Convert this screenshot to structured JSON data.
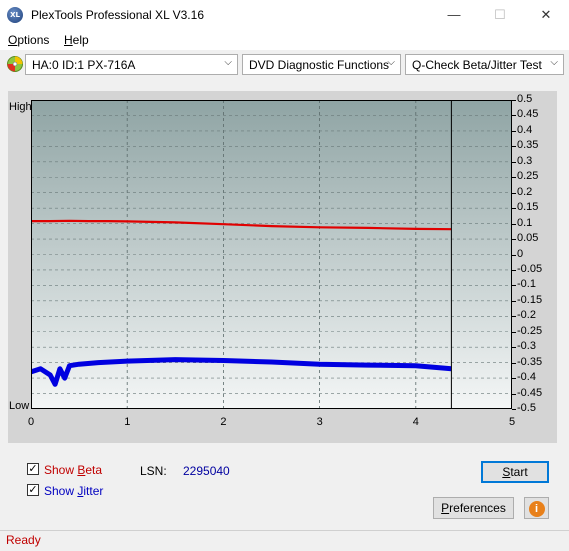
{
  "window": {
    "title": "PlexTools Professional XL V3.16",
    "icon_text": "XL",
    "minimize": "—",
    "maximize": "☐",
    "close": "✕"
  },
  "menu": {
    "options_first": "O",
    "options_rest": "ptions",
    "help_first": "H",
    "help_rest": "elp"
  },
  "toolbar": {
    "drive": "HA:0 ID:1  PX-716A",
    "function": "DVD Diagnostic Functions",
    "test": "Q-Check Beta/Jitter Test"
  },
  "chart_data": {
    "type": "line",
    "left_axis_labels": [
      "High",
      "Low"
    ],
    "x_ticks": [
      0,
      1,
      2,
      3,
      4,
      5
    ],
    "y_ticks": [
      0.5,
      0.45,
      0.4,
      0.35,
      0.3,
      0.25,
      0.2,
      0.15,
      0.1,
      0.05,
      0,
      -0.05,
      -0.1,
      -0.15,
      -0.2,
      -0.25,
      -0.3,
      -0.35,
      -0.4,
      -0.45,
      -0.5
    ],
    "xlim": [
      0,
      5
    ],
    "ylim": [
      -0.5,
      0.5
    ],
    "end_marker_x": 4.37,
    "series": [
      {
        "name": "Beta",
        "color": "#e00000",
        "x": [
          0,
          0.2,
          0.4,
          0.6,
          0.8,
          1.0,
          1.5,
          2.0,
          2.5,
          3.0,
          3.5,
          4.0,
          4.37
        ],
        "y": [
          0.108,
          0.108,
          0.109,
          0.108,
          0.108,
          0.107,
          0.104,
          0.098,
          0.092,
          0.088,
          0.086,
          0.083,
          0.082
        ]
      },
      {
        "name": "Jitter",
        "color": "#0000e0",
        "x": [
          0,
          0.1,
          0.2,
          0.25,
          0.3,
          0.35,
          0.4,
          0.5,
          0.7,
          1.0,
          1.5,
          2.0,
          2.5,
          3.0,
          3.5,
          4.0,
          4.37
        ],
        "y": [
          -0.38,
          -0.37,
          -0.39,
          -0.42,
          -0.37,
          -0.4,
          -0.36,
          -0.355,
          -0.35,
          -0.345,
          -0.34,
          -0.343,
          -0.348,
          -0.355,
          -0.358,
          -0.36,
          -0.37
        ]
      }
    ]
  },
  "controls": {
    "show_beta_pre": "Show ",
    "show_beta_u": "B",
    "show_beta_post": "eta",
    "show_jitter_pre": "Show ",
    "show_jitter_u": "J",
    "show_jitter_post": "itter",
    "lsn_label": "LSN:",
    "lsn_value": "2295040",
    "start_u": "S",
    "start_rest": "tart",
    "preferences_u": "P",
    "preferences_rest": "references",
    "info_glyph": "i",
    "checkmark": "✓"
  },
  "status": {
    "text": "Ready"
  },
  "colors": {
    "beta": "#e00000",
    "jitter": "#0000e0",
    "status": "#c00000",
    "axis_text": "#0000a0"
  }
}
